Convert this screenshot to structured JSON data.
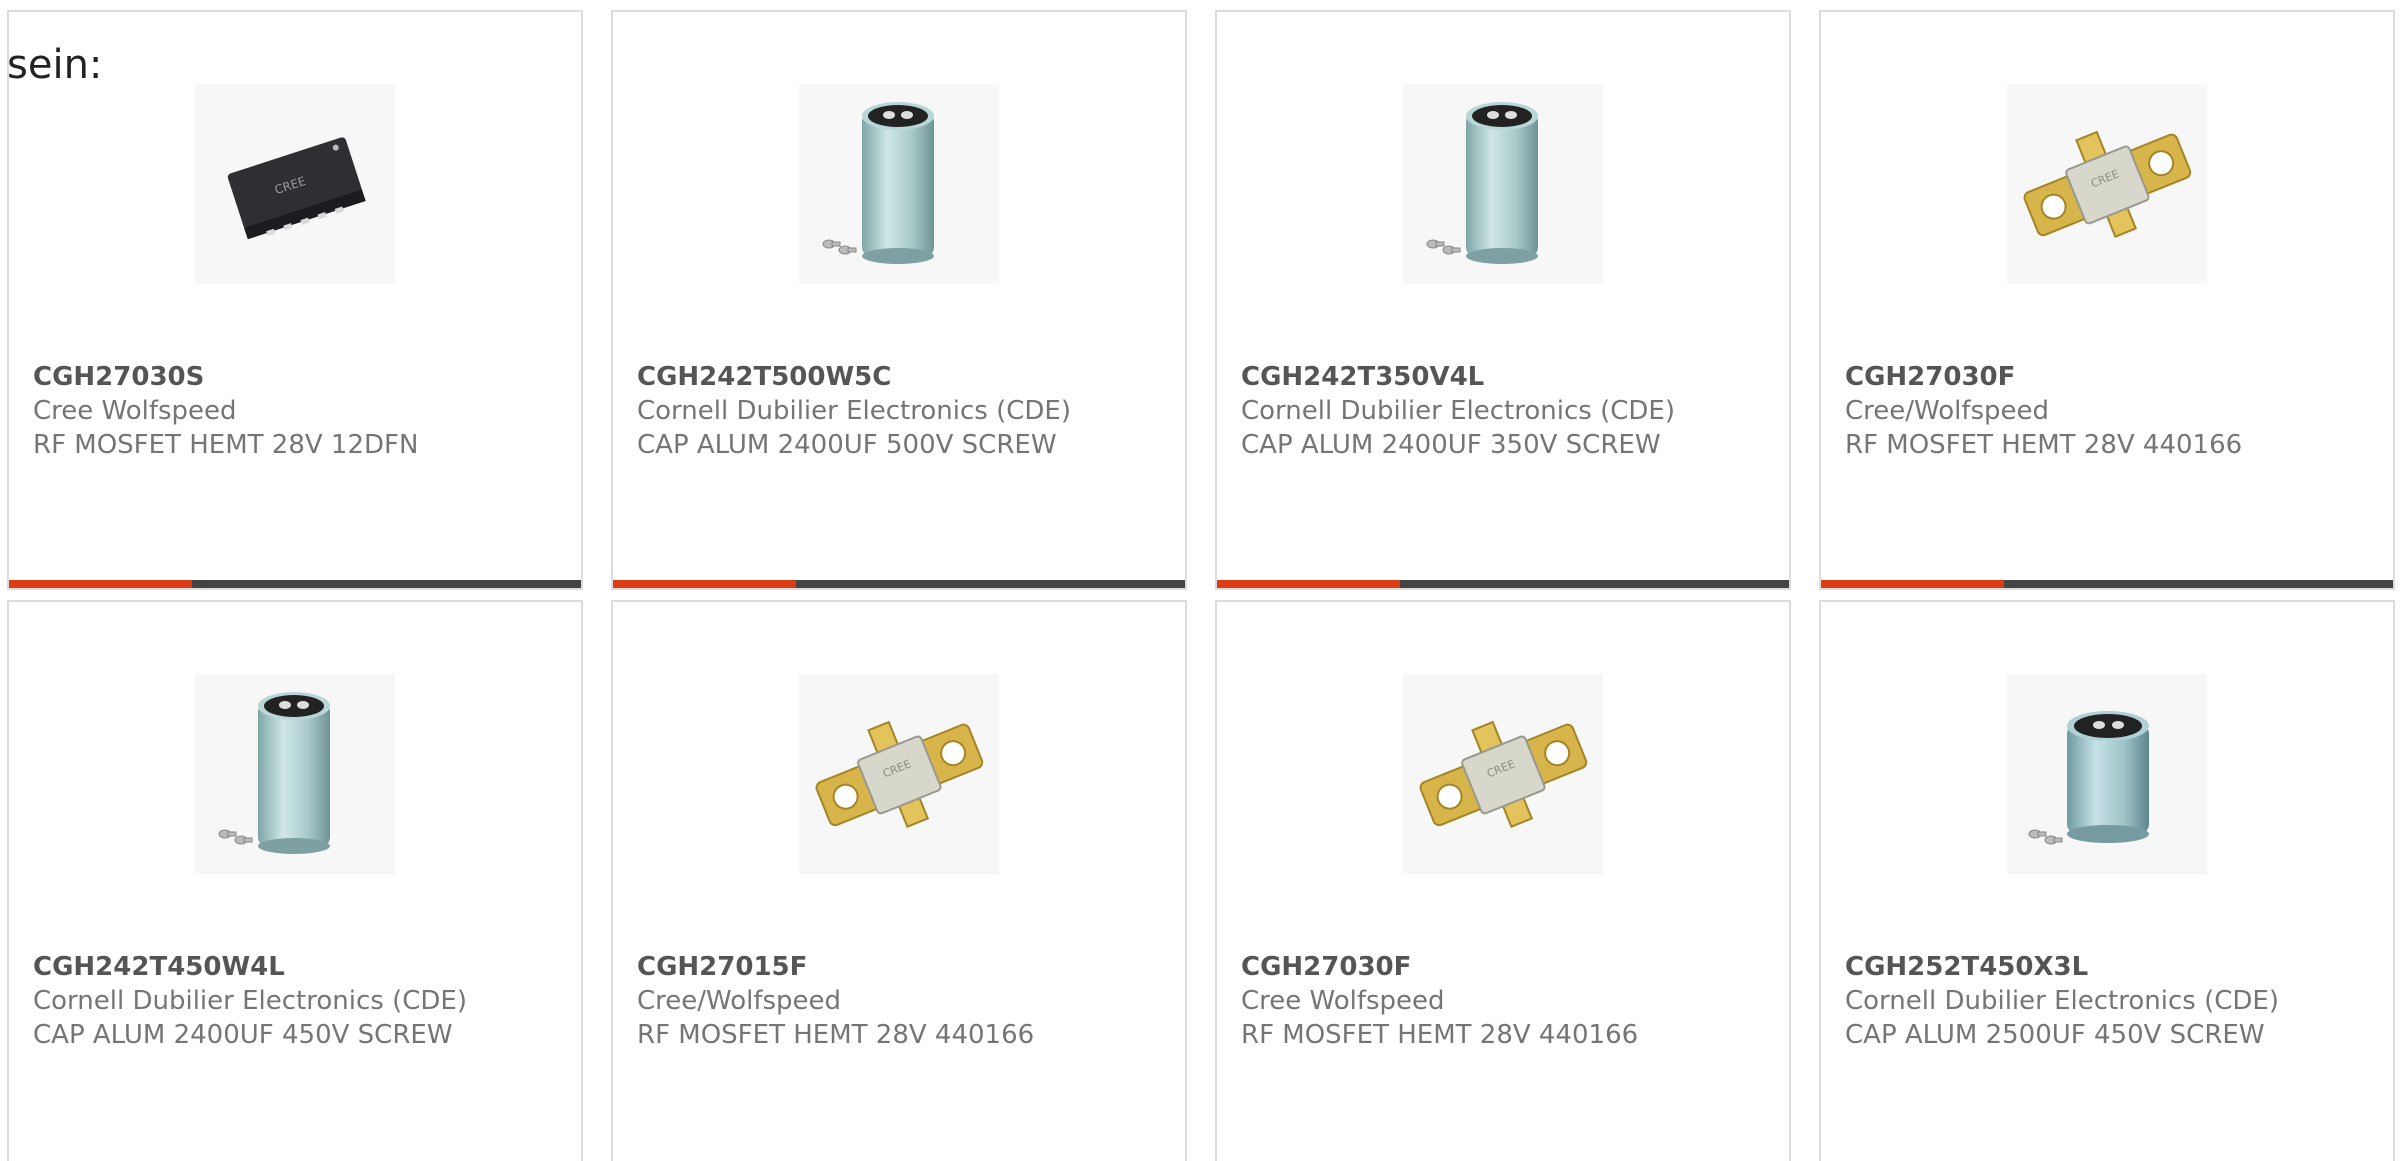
{
  "intro_text": "sein:",
  "colors": {
    "accent": "#dd3b13",
    "bar_track": "#444444",
    "card_border": "#dcdcdc",
    "part_number": "#555555",
    "meta_text": "#757575"
  },
  "products": [
    {
      "part_number": "CGH27030S",
      "manufacturer": "Cree Wolfspeed",
      "description": "RF MOSFET HEMT 28V 12DFN",
      "image_icon": "dfn-chip-icon",
      "bar_fill": 0.32
    },
    {
      "part_number": "CGH242T500W5C",
      "manufacturer": "Cornell Dubilier Electronics (CDE)",
      "description": "CAP ALUM 2400UF 500V SCREW",
      "image_icon": "capacitor-icon",
      "bar_fill": 0.32
    },
    {
      "part_number": "CGH242T350V4L",
      "manufacturer": "Cornell Dubilier Electronics (CDE)",
      "description": "CAP ALUM 2400UF 350V SCREW",
      "image_icon": "capacitor-icon",
      "bar_fill": 0.32
    },
    {
      "part_number": "CGH27030F",
      "manufacturer": "Cree/Wolfspeed",
      "description": "RF MOSFET HEMT 28V 440166",
      "image_icon": "flange-transistor-icon",
      "bar_fill": 0.32
    },
    {
      "part_number": "CGH242T450W4L",
      "manufacturer": "Cornell Dubilier Electronics (CDE)",
      "description": "CAP ALUM 2400UF 450V SCREW",
      "image_icon": "capacitor-icon"
    },
    {
      "part_number": "CGH27015F",
      "manufacturer": "Cree/Wolfspeed",
      "description": "RF MOSFET HEMT 28V 440166",
      "image_icon": "flange-transistor-icon"
    },
    {
      "part_number": "CGH27030F",
      "manufacturer": "Cree Wolfspeed",
      "description": "RF MOSFET HEMT 28V 440166",
      "image_icon": "flange-transistor-icon"
    },
    {
      "part_number": "CGH252T450X3L",
      "manufacturer": "Cornell Dubilier Electronics (CDE)",
      "description": "CAP ALUM 2500UF 450V SCREW",
      "image_icon": "capacitor-small-icon"
    }
  ]
}
